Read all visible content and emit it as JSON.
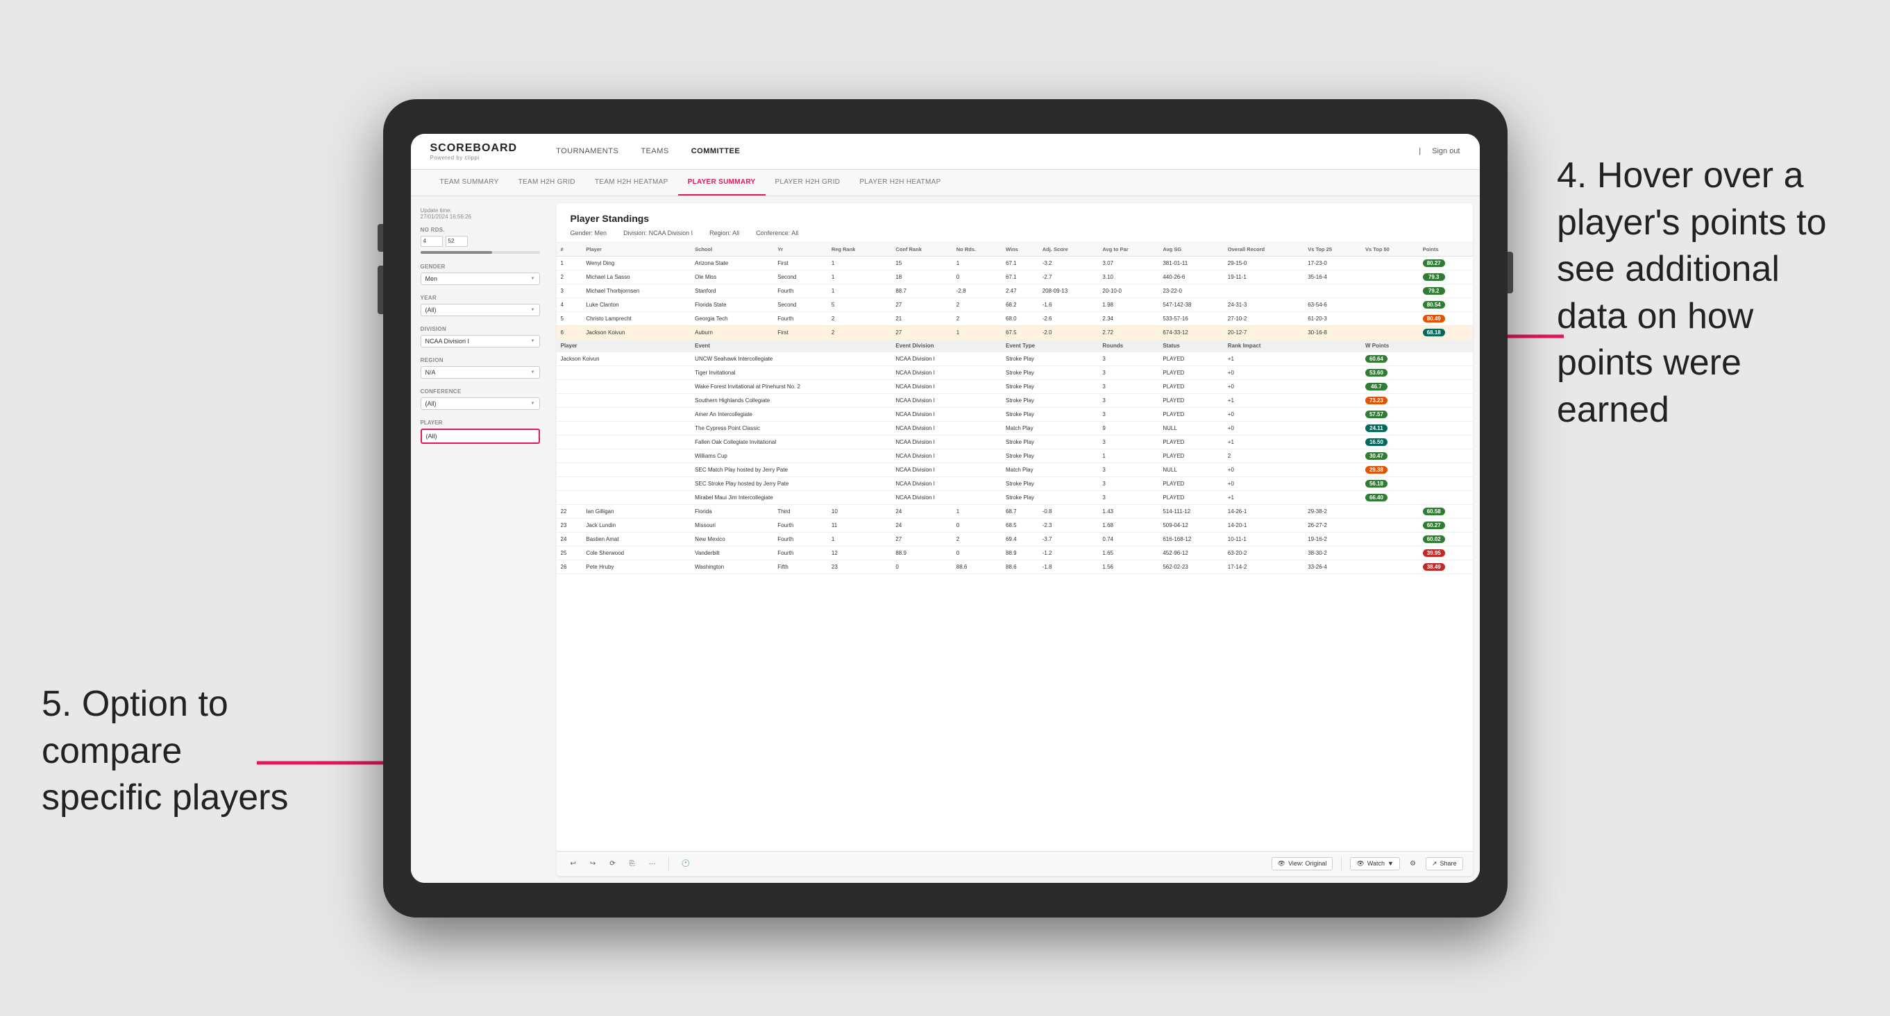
{
  "page": {
    "background": "#e8e8e8"
  },
  "annotations": {
    "top_right": "4. Hover over a player's points to see additional data on how points were earned",
    "bottom_left": "5. Option to compare specific players"
  },
  "header": {
    "logo": "SCOREBOARD",
    "logo_sub": "Powered by clippi",
    "nav_items": [
      "TOURNAMENTS",
      "TEAMS",
      "COMMITTEE"
    ],
    "active_nav": "COMMITTEE",
    "right_items": [
      "Sign out"
    ]
  },
  "sub_nav": {
    "items": [
      "TEAM SUMMARY",
      "TEAM H2H GRID",
      "TEAM H2H HEATMAP",
      "PLAYER SUMMARY",
      "PLAYER H2H GRID",
      "PLAYER H2H HEATMAP"
    ],
    "active": "PLAYER SUMMARY"
  },
  "sidebar": {
    "update_time_label": "Update time:",
    "update_time_value": "27/01/2024 16:56:26",
    "no_rds_label": "No Rds.",
    "no_rds_from": "4",
    "no_rds_to": "52",
    "gender_label": "Gender",
    "gender_value": "Men",
    "year_label": "Year",
    "year_value": "(All)",
    "division_label": "Division",
    "division_value": "NCAA Division I",
    "region_label": "Region",
    "region_value": "N/A",
    "conference_label": "Conference",
    "conference_value": "(All)",
    "player_label": "Player",
    "player_value": "(All)"
  },
  "panel": {
    "title": "Player Standings",
    "filters": {
      "gender_label": "Gender:",
      "gender_value": "Men",
      "division_label": "Division:",
      "division_value": "NCAA Division I",
      "region_label": "Region:",
      "region_value": "All",
      "conference_label": "Conference:",
      "conference_value": "All"
    },
    "table_headers": [
      "#",
      "Player",
      "School",
      "Yr",
      "Reg Rank",
      "Conf Rank",
      "No Rds.",
      "Wins",
      "Adj. Score",
      "Avg to Par",
      "Avg SG",
      "Overall Record",
      "Vs Top 25",
      "Vs Top 50",
      "Points"
    ],
    "rows": [
      {
        "rank": "1",
        "player": "Wenyi Ding",
        "school": "Arizona State",
        "yr": "First",
        "reg_rank": "1",
        "conf_rank": "15",
        "no_rds": "1",
        "wins": "67.1",
        "adj_score": "-3.2",
        "avg_to_par": "3.07",
        "avg_sg": "381-01-11",
        "overall": "29-15-0",
        "vs25": "17-23-0",
        "vs50": "",
        "points": "80.27",
        "badge": "green"
      },
      {
        "rank": "2",
        "player": "Michael La Sasso",
        "school": "Ole Miss",
        "yr": "Second",
        "reg_rank": "1",
        "conf_rank": "18",
        "no_rds": "0",
        "wins": "67.1",
        "adj_score": "-2.7",
        "avg_to_par": "3.10",
        "avg_sg": "440-26-6",
        "overall": "19-11-1",
        "vs25": "35-16-4",
        "vs50": "",
        "points": "79.3",
        "badge": "green"
      },
      {
        "rank": "3",
        "player": "Michael Thorbjornsen",
        "school": "Stanford",
        "yr": "Fourth",
        "reg_rank": "1",
        "conf_rank": "88.7",
        "no_rds": "-2.8",
        "wins": "2.47",
        "adj_score": "208-09-13",
        "avg_to_par": "20-10-0",
        "avg_sg": "23-22-0",
        "overall": "",
        "vs25": "",
        "vs50": "",
        "points": "79.2",
        "badge": "green"
      },
      {
        "rank": "4",
        "player": "Luke Clanton",
        "school": "Florida State",
        "yr": "Second",
        "reg_rank": "5",
        "conf_rank": "27",
        "no_rds": "2",
        "wins": "68.2",
        "adj_score": "-1.6",
        "avg_to_par": "1.98",
        "avg_sg": "547-142-38",
        "overall": "24-31-3",
        "vs25": "63-54-6",
        "vs50": "",
        "points": "80.54",
        "badge": "green"
      },
      {
        "rank": "5",
        "player": "Christo Lamprecht",
        "school": "Georgia Tech",
        "yr": "Fourth",
        "reg_rank": "2",
        "conf_rank": "21",
        "no_rds": "2",
        "wins": "68.0",
        "adj_score": "-2.6",
        "avg_to_par": "2.34",
        "avg_sg": "533-57-16",
        "overall": "27-10-2",
        "vs25": "61-20-3",
        "vs50": "",
        "points": "80.49",
        "badge": "orange"
      },
      {
        "rank": "6",
        "player": "Jackson Koivun",
        "school": "Auburn",
        "yr": "First",
        "reg_rank": "2",
        "conf_rank": "27",
        "no_rds": "1",
        "wins": "67.5",
        "adj_score": "-2.0",
        "avg_to_par": "2.72",
        "avg_sg": "674-33-12",
        "overall": "20-12-7",
        "vs25": "30-16-8",
        "vs50": "",
        "points": "68.18",
        "badge": "teal"
      }
    ],
    "tooltip_rows": [
      {
        "player": "Jackson Koivun",
        "event": "UNCW Seahawk Intercollegiate",
        "event_div": "NCAA Division I",
        "event_type": "Stroke Play",
        "rounds": "3",
        "status": "PLAYED",
        "rank_impact": "+1",
        "w_points": "60.64",
        "badge": "green"
      },
      {
        "player": "",
        "event": "Tiger Invitational",
        "event_div": "NCAA Division I",
        "event_type": "Stroke Play",
        "rounds": "3",
        "status": "PLAYED",
        "rank_impact": "+0",
        "w_points": "53.60",
        "badge": "green"
      },
      {
        "player": "",
        "event": "Wake Forest Invitational at Pinehurst No. 2",
        "event_div": "NCAA Division I",
        "event_type": "Stroke Play",
        "rounds": "3",
        "status": "PLAYED",
        "rank_impact": "+0",
        "w_points": "46.7",
        "badge": "green"
      },
      {
        "player": "",
        "event": "Southern Highlands Collegiate",
        "event_div": "NCAA Division I",
        "event_type": "Stroke Play",
        "rounds": "3",
        "status": "PLAYED",
        "rank_impact": "+1",
        "w_points": "73.23",
        "badge": "orange"
      },
      {
        "player": "",
        "event": "Amer An Intercollegiate",
        "event_div": "NCAA Division I",
        "event_type": "Stroke Play",
        "rounds": "3",
        "status": "PLAYED",
        "rank_impact": "+0",
        "w_points": "57.57",
        "badge": "green"
      },
      {
        "player": "",
        "event": "The Cypress Point Classic",
        "event_div": "NCAA Division I",
        "event_type": "Match Play",
        "rounds": "9",
        "status": "NULL",
        "rank_impact": "+0",
        "w_points": "24.11",
        "badge": "teal"
      },
      {
        "player": "",
        "event": "Fallen Oak Collegiate Invitational",
        "event_div": "NCAA Division I",
        "event_type": "Stroke Play",
        "rounds": "3",
        "status": "PLAYED",
        "rank_impact": "+1",
        "w_points": "16.50",
        "badge": "teal"
      },
      {
        "player": "",
        "event": "Williams Cup",
        "event_div": "NCAA Division I",
        "event_type": "Stroke Play",
        "rounds": "1",
        "status": "PLAYED",
        "rank_impact": "2",
        "w_points": "30.47",
        "badge": "green"
      },
      {
        "player": "",
        "event": "SEC Match Play hosted by Jerry Pate",
        "event_div": "NCAA Division I",
        "event_type": "Match Play",
        "rounds": "3",
        "status": "NULL",
        "rank_impact": "+0",
        "w_points": "29.38",
        "badge": "orange"
      },
      {
        "player": "",
        "event": "SEC Stroke Play hosted by Jerry Pate",
        "event_div": "NCAA Division I",
        "event_type": "Stroke Play",
        "rounds": "3",
        "status": "PLAYED",
        "rank_impact": "+0",
        "w_points": "56.18",
        "badge": "green"
      },
      {
        "player": "",
        "event": "Mirabel Maui Jim Intercollegiate",
        "event_div": "NCAA Division I",
        "event_type": "Stroke Play",
        "rounds": "3",
        "status": "PLAYED",
        "rank_impact": "+1",
        "w_points": "66.40",
        "badge": "green"
      }
    ],
    "more_rows": [
      {
        "rank": "22",
        "player": "Ian Gilligan",
        "school": "Florida",
        "yr": "Third",
        "reg_rank": "10",
        "conf_rank": "24",
        "no_rds": "1",
        "wins": "68.7",
        "adj_score": "-0.8",
        "avg_to_par": "1.43",
        "avg_sg": "514-111-12",
        "overall": "14-26-1",
        "vs25": "29-38-2",
        "vs50": "",
        "points": "60.58",
        "badge": "green"
      },
      {
        "rank": "23",
        "player": "Jack Lundin",
        "school": "Missouri",
        "yr": "Fourth",
        "reg_rank": "11",
        "conf_rank": "24",
        "no_rds": "0",
        "wins": "68.5",
        "adj_score": "-2.3",
        "avg_to_par": "1.68",
        "avg_sg": "509-04-12",
        "overall": "14-20-1",
        "vs25": "26-27-2",
        "vs50": "",
        "points": "60.27",
        "badge": "green"
      },
      {
        "rank": "24",
        "player": "Bastien Amat",
        "school": "New Mexico",
        "yr": "Fourth",
        "reg_rank": "1",
        "conf_rank": "27",
        "no_rds": "2",
        "wins": "69.4",
        "adj_score": "-3.7",
        "avg_to_par": "0.74",
        "avg_sg": "616-168-12",
        "overall": "10-11-1",
        "vs25": "19-16-2",
        "vs50": "",
        "points": "60.02",
        "badge": "green"
      },
      {
        "rank": "25",
        "player": "Cole Sherwood",
        "school": "Vanderbilt",
        "yr": "Fourth",
        "reg_rank": "12",
        "conf_rank": "88.9",
        "no_rds": "0",
        "wins": "88.9",
        "adj_score": "-1.2",
        "avg_to_par": "1.65",
        "avg_sg": "452-96-12",
        "overall": "63-20-2",
        "vs25": "38-30-2",
        "vs50": "",
        "points": "39.95",
        "badge": "red"
      },
      {
        "rank": "26",
        "player": "Pete Hruby",
        "school": "Washington",
        "yr": "Fifth",
        "reg_rank": "23",
        "conf_rank": "0",
        "no_rds": "88.6",
        "wins": "88.6",
        "adj_score": "-1.8",
        "avg_to_par": "1.56",
        "avg_sg": "562-02-23",
        "overall": "17-14-2",
        "vs25": "33-26-4",
        "vs50": "",
        "points": "38.49",
        "badge": "red"
      }
    ],
    "toolbar": {
      "view_original": "View: Original",
      "watch": "Watch",
      "share": "Share"
    }
  }
}
